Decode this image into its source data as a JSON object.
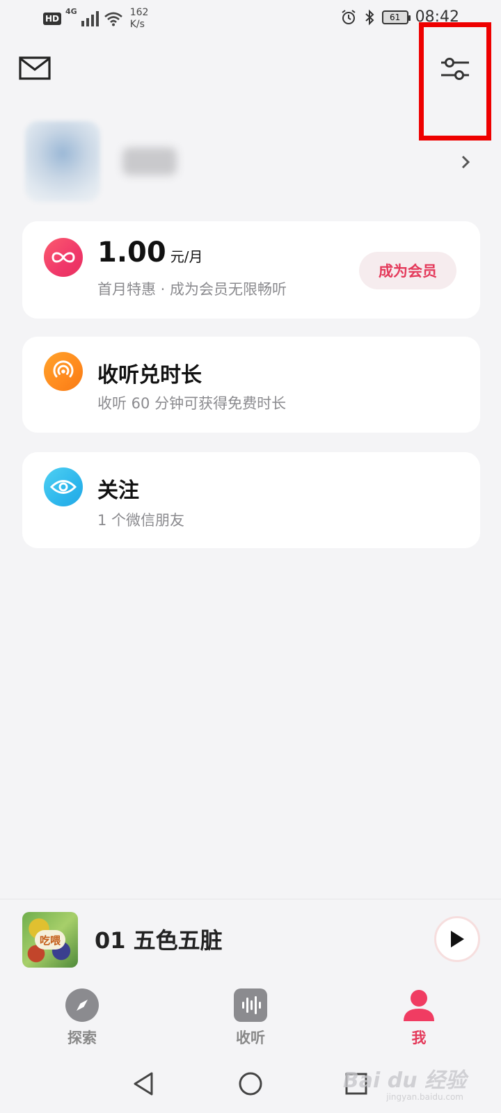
{
  "status_bar": {
    "hd": "HD",
    "network": "4G",
    "speed_value": "162",
    "speed_unit": "K/s",
    "battery": "61",
    "time": "08:42"
  },
  "header": {
    "mail_icon": "mail-icon",
    "settings_icon": "sliders-icon",
    "highlight_color": "#ee0000"
  },
  "profile": {
    "avatar": "blurred",
    "nickname": "blurred"
  },
  "vip": {
    "price": "1.00",
    "unit": "元/月",
    "subtitle": "首月特惠 · 成为会员无限畅听",
    "button": "成为会员",
    "icon": "infinity-icon"
  },
  "listen": {
    "title": "收听兑时长",
    "subtitle": "收听 60 分钟可获得免费时长",
    "icon": "radio-waves-icon"
  },
  "follow": {
    "title": "关注",
    "subtitle": "1 个微信朋友",
    "icon": "eye-icon"
  },
  "player": {
    "title": "01 五色五脏",
    "cover_tag": "吃喂"
  },
  "nav": {
    "items": [
      {
        "label": "探索",
        "icon": "compass-icon",
        "active": false
      },
      {
        "label": "收听",
        "icon": "waveform-icon",
        "active": false
      },
      {
        "label": "我",
        "icon": "person-icon",
        "active": true
      }
    ]
  },
  "watermark": {
    "text": "Bai du 经验",
    "sub": "jingyan.baidu.com"
  },
  "colors": {
    "accent": "#e4395a",
    "background": "#f4f4f6"
  }
}
